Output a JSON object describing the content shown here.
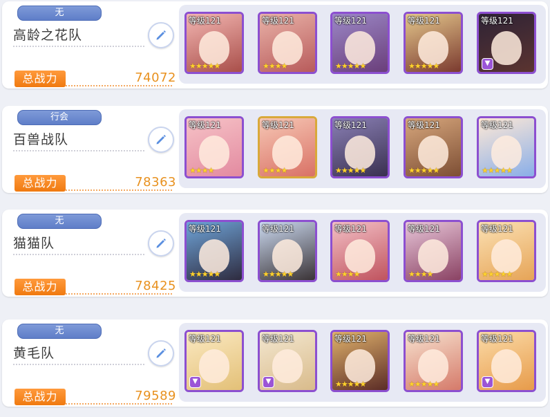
{
  "level_label": "等级121",
  "teams": [
    {
      "tag": "无",
      "name": "高龄之花队",
      "power_label": "总战力",
      "power": "74072",
      "members": [
        {
          "stars": "★★★★★",
          "frame": "purple",
          "bg": [
            "#f3b6b2",
            "#a94f4a"
          ],
          "rank": false
        },
        {
          "stars": "★★★★",
          "frame": "purple",
          "bg": [
            "#e9b2a8",
            "#b85b5b"
          ],
          "rank": false
        },
        {
          "stars": "★★★★★",
          "frame": "purple",
          "bg": [
            "#9c88c7",
            "#6a3e7a"
          ],
          "rank": false
        },
        {
          "stars": "★★★★★",
          "frame": "purple",
          "bg": [
            "#e4c78c",
            "#7b3a2f"
          ],
          "rank": false
        },
        {
          "stars": "",
          "frame": "purple",
          "bg": [
            "#2e2336",
            "#5b3430"
          ],
          "rank": true
        }
      ]
    },
    {
      "tag": "行会",
      "name": "百兽战队",
      "power_label": "总战力",
      "power": "78363",
      "members": [
        {
          "stars": "★★★★",
          "frame": "purple",
          "bg": [
            "#f6c3c7",
            "#e38aa0"
          ],
          "rank": false
        },
        {
          "stars": "★★★★",
          "frame": "gold",
          "bg": [
            "#f6c7b5",
            "#d97165"
          ],
          "rank": false
        },
        {
          "stars": "★★★★★",
          "frame": "purple",
          "bg": [
            "#8a80b5",
            "#3a3050"
          ],
          "rank": false
        },
        {
          "stars": "★★★★★",
          "frame": "purple",
          "bg": [
            "#d7a77d",
            "#7d4e34"
          ],
          "rank": false
        },
        {
          "stars": "★★★★★",
          "frame": "purple",
          "bg": [
            "#ffe9d6",
            "#89aee8"
          ],
          "rank": false
        }
      ]
    },
    {
      "tag": "无",
      "name": "猫猫队",
      "power_label": "总战力",
      "power": "78425",
      "members": [
        {
          "stars": "★★★★★",
          "frame": "purple",
          "bg": [
            "#6fa4d8",
            "#2e2b3f"
          ],
          "rank": false
        },
        {
          "stars": "★★★★★",
          "frame": "purple",
          "bg": [
            "#cbd9f0",
            "#3a3336"
          ],
          "rank": false
        },
        {
          "stars": "★★★★",
          "frame": "purple",
          "bg": [
            "#f3c0c6",
            "#c0535e"
          ],
          "rank": false
        },
        {
          "stars": "★★★★",
          "frame": "purple",
          "bg": [
            "#e8c6d9",
            "#8a4263"
          ],
          "rank": false
        },
        {
          "stars": "★★★★★",
          "frame": "purple",
          "bg": [
            "#fbe1b4",
            "#e6a457"
          ],
          "rank": false
        }
      ]
    },
    {
      "tag": "无",
      "name": "黄毛队",
      "power_label": "总战力",
      "power": "79589",
      "members": [
        {
          "stars": "",
          "frame": "purple",
          "bg": [
            "#fbe9c2",
            "#e3c077"
          ],
          "rank": true
        },
        {
          "stars": "",
          "frame": "purple",
          "bg": [
            "#f3e7d0",
            "#d9bb8b"
          ],
          "rank": true
        },
        {
          "stars": "★★★★★",
          "frame": "purple",
          "bg": [
            "#e0b26c",
            "#5b2c26"
          ],
          "rank": false
        },
        {
          "stars": "★★★★★",
          "frame": "purple",
          "bg": [
            "#f7e2cf",
            "#d57a6a"
          ],
          "rank": false
        },
        {
          "stars": "",
          "frame": "purple",
          "bg": [
            "#fbdba8",
            "#e79b4a"
          ],
          "rank": true
        }
      ]
    }
  ]
}
